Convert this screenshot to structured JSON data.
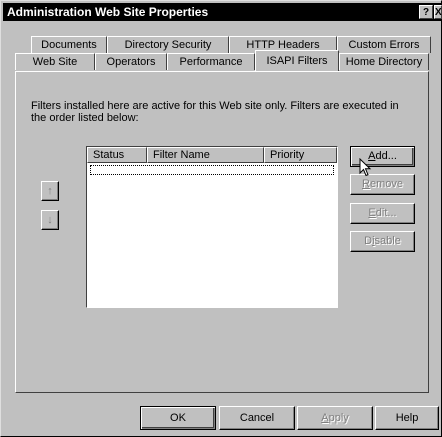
{
  "window": {
    "title": "Administration Web Site Properties",
    "help_glyph": "?",
    "close_glyph": "X"
  },
  "tabs": {
    "back_row": [
      "Documents",
      "Directory Security",
      "HTTP Headers",
      "Custom Errors"
    ],
    "front_row": [
      "Web Site",
      "Operators",
      "Performance",
      "ISAPI Filters",
      "Home Directory"
    ],
    "active": "ISAPI Filters"
  },
  "filters": {
    "description": "Filters installed here are active for this Web site only. Filters are executed in the order listed below:",
    "columns": [
      "Status",
      "Filter Name",
      "Priority"
    ],
    "rows": [],
    "move_up_glyph": "↑",
    "move_down_glyph": "↓",
    "add_label": "Add...",
    "add_underline": "A",
    "add_rest": "dd...",
    "remove_label": "Remove",
    "remove_underline": "R",
    "remove_rest": "emove",
    "edit_label": "Edit...",
    "edit_underline": "E",
    "edit_rest": "dit...",
    "disable_label": "Disable",
    "disable_pre": "D",
    "disable_underline": "i",
    "disable_rest": "sable"
  },
  "footer": {
    "ok_label": "OK",
    "cancel_label": "Cancel",
    "apply_label": "Apply",
    "apply_underline": "A",
    "apply_rest": "pply",
    "help_label": "Help"
  }
}
